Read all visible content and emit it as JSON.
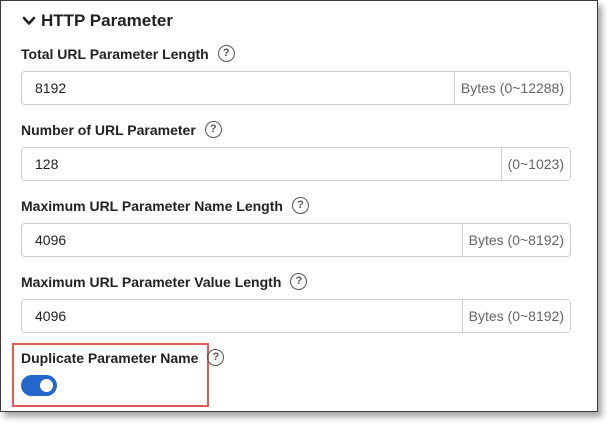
{
  "section": {
    "title": "HTTP Parameter",
    "icon": "chevron-down-icon"
  },
  "fields": [
    {
      "label": "Total URL Parameter Length",
      "value": "8192",
      "suffix": "Bytes (0~12288)"
    },
    {
      "label": "Number of URL Parameter",
      "value": "128",
      "suffix": "(0~1023)"
    },
    {
      "label": "Maximum URL Parameter Name Length",
      "value": "4096",
      "suffix": "Bytes (0~8192)"
    },
    {
      "label": "Maximum URL Parameter Value Length",
      "value": "4096",
      "suffix": "Bytes (0~8192)"
    }
  ],
  "duplicate": {
    "label": "Duplicate Parameter Name",
    "enabled": true
  },
  "help_glyph": "?",
  "colors": {
    "toggle_on": "#2466c9",
    "highlight": "#e05a5a",
    "text": "#222222"
  }
}
